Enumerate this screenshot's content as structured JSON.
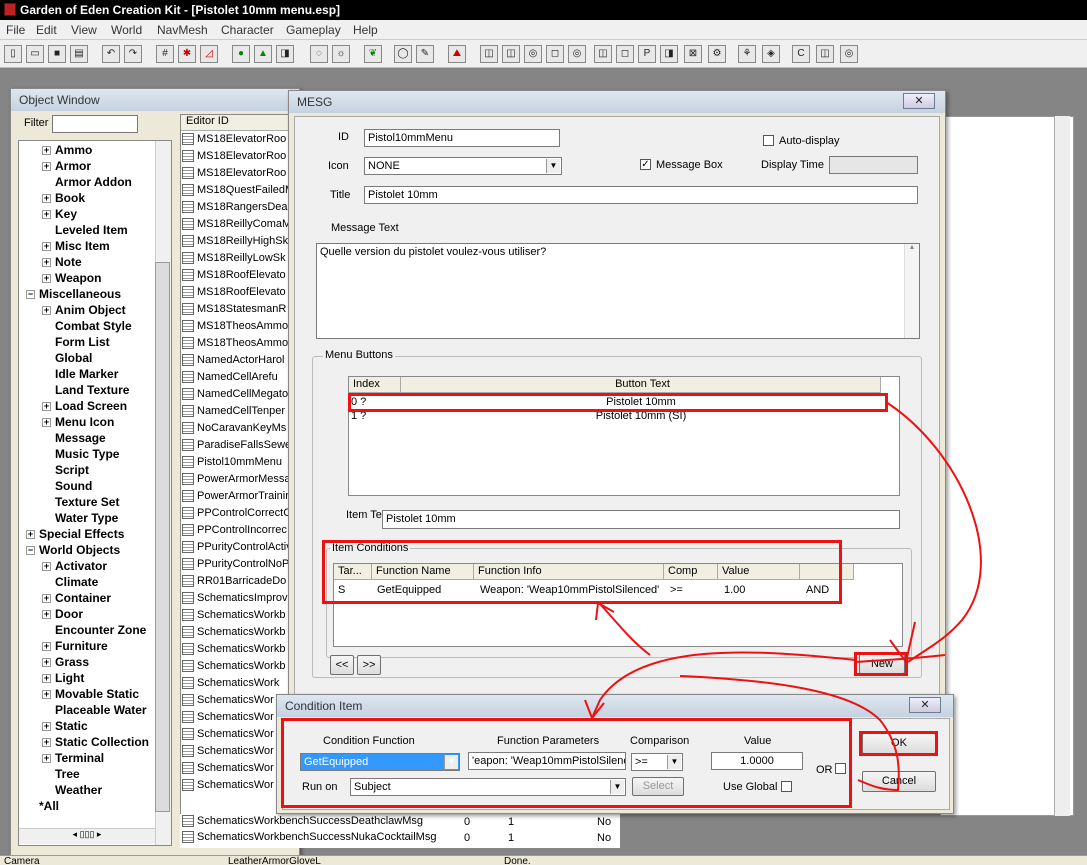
{
  "app": {
    "title": "Garden of Eden Creation Kit - [Pistolet 10mm menu.esp]"
  },
  "menu": [
    "File",
    "Edit",
    "View",
    "World",
    "NavMesh",
    "Character",
    "Gameplay",
    "Help"
  ],
  "object_window": {
    "title": "Object Window",
    "filter_label": "Filter",
    "editor_id_header": "Editor ID",
    "tree": [
      {
        "label": "Ammo",
        "level": 1,
        "exp": "+"
      },
      {
        "label": "Armor",
        "level": 1,
        "exp": "+"
      },
      {
        "label": "Armor Addon",
        "level": 1,
        "exp": ""
      },
      {
        "label": "Book",
        "level": 1,
        "exp": "+"
      },
      {
        "label": "Key",
        "level": 1,
        "exp": "+"
      },
      {
        "label": "Leveled Item",
        "level": 1,
        "exp": ""
      },
      {
        "label": "Misc Item",
        "level": 1,
        "exp": "+"
      },
      {
        "label": "Note",
        "level": 1,
        "exp": "+"
      },
      {
        "label": "Weapon",
        "level": 1,
        "exp": "+"
      },
      {
        "label": "Miscellaneous",
        "level": 0,
        "exp": "−"
      },
      {
        "label": "Anim Object",
        "level": 1,
        "exp": "+"
      },
      {
        "label": "Combat Style",
        "level": 1,
        "exp": ""
      },
      {
        "label": "Form List",
        "level": 1,
        "exp": ""
      },
      {
        "label": "Global",
        "level": 1,
        "exp": ""
      },
      {
        "label": "Idle Marker",
        "level": 1,
        "exp": ""
      },
      {
        "label": "Land Texture",
        "level": 1,
        "exp": ""
      },
      {
        "label": "Load Screen",
        "level": 1,
        "exp": "+"
      },
      {
        "label": "Menu Icon",
        "level": 1,
        "exp": "+"
      },
      {
        "label": "Message",
        "level": 1,
        "exp": ""
      },
      {
        "label": "Music Type",
        "level": 1,
        "exp": ""
      },
      {
        "label": "Script",
        "level": 1,
        "exp": ""
      },
      {
        "label": "Sound",
        "level": 1,
        "exp": ""
      },
      {
        "label": "Texture Set",
        "level": 1,
        "exp": ""
      },
      {
        "label": "Water Type",
        "level": 1,
        "exp": ""
      },
      {
        "label": "Special Effects",
        "level": 0,
        "exp": "+"
      },
      {
        "label": "World Objects",
        "level": 0,
        "exp": "−"
      },
      {
        "label": "Activator",
        "level": 1,
        "exp": "+"
      },
      {
        "label": "Climate",
        "level": 1,
        "exp": ""
      },
      {
        "label": "Container",
        "level": 1,
        "exp": "+"
      },
      {
        "label": "Door",
        "level": 1,
        "exp": "+"
      },
      {
        "label": "Encounter Zone",
        "level": 1,
        "exp": ""
      },
      {
        "label": "Furniture",
        "level": 1,
        "exp": "+"
      },
      {
        "label": "Grass",
        "level": 1,
        "exp": "+"
      },
      {
        "label": "Light",
        "level": 1,
        "exp": "+"
      },
      {
        "label": "Movable Static",
        "level": 1,
        "exp": "+"
      },
      {
        "label": "Placeable Water",
        "level": 1,
        "exp": ""
      },
      {
        "label": "Static",
        "level": 1,
        "exp": "+"
      },
      {
        "label": "Static Collection",
        "level": 1,
        "exp": "+"
      },
      {
        "label": "Terminal",
        "level": 1,
        "exp": "+"
      },
      {
        "label": "Tree",
        "level": 1,
        "exp": ""
      },
      {
        "label": "Weather",
        "level": 1,
        "exp": ""
      },
      {
        "label": "*All",
        "level": 0,
        "exp": ""
      }
    ],
    "editor_ids": [
      "MS18ElevatorRoo",
      "MS18ElevatorRoo",
      "MS18ElevatorRoo",
      "MS18QuestFailedM",
      "MS18RangersDea",
      "MS18ReillyComaM",
      "MS18ReillyHighSk",
      "MS18ReillyLowSk",
      "MS18RoofElevato",
      "MS18RoofElevato",
      "MS18StatesmanR",
      "MS18TheosAmmo",
      "MS18TheosAmmo",
      "NamedActorHarol",
      "NamedCellArefu",
      "NamedCellMegato",
      "NamedCellTenper",
      "NoCaravanKeyMs",
      "ParadiseFallsSewe",
      "Pistol10mmMenu",
      "PowerArmorMessa",
      "PowerArmorTrainin",
      "PPControlCorrectC",
      "PPControlIncorrec",
      "PPurityControlActiv",
      "PPurityControlNoP",
      "RR01BarricadeDo",
      "SchematicsImprov",
      "SchematicsWorkb",
      "SchematicsWorkb",
      "SchematicsWorkb",
      "SchematicsWorkb",
      "SchematicsWork",
      "SchematicsWor",
      "SchematicsWor",
      "SchematicsWor",
      "SchematicsWor",
      "SchematicsWor",
      "SchematicsWor"
    ],
    "bottom_rows": [
      {
        "id": "SchematicsWorkbenchSuccessDeathclawMsg",
        "c1": "0",
        "c2": "1",
        "c3": "No"
      },
      {
        "id": "SchematicsWorkbenchSuccessNukaCocktailMsg",
        "c1": "0",
        "c2": "1",
        "c3": "No"
      }
    ]
  },
  "mesg": {
    "title": "MESG",
    "id_label": "ID",
    "id_value": "Pistol10mmMenu",
    "icon_label": "Icon",
    "icon_value": "NONE",
    "title_label": "Title",
    "title_value": "Pistolet 10mm",
    "auto_display": "Auto-display",
    "message_box": "Message Box",
    "display_time": "Display Time",
    "message_text_label": "Message Text",
    "message_text": "Quelle version du pistolet voulez-vous utiliser?",
    "menu_buttons_label": "Menu Buttons",
    "btn_cols": [
      "Index",
      "Button Text"
    ],
    "btn_rows": [
      {
        "index": "0 ?",
        "text": "Pistolet 10mm"
      },
      {
        "index": "1 ?",
        "text": "Pistolet 10mm (SI)"
      }
    ],
    "item_text_label": "Item Text",
    "item_text": "Pistolet 10mm",
    "item_conditions_label": "Item Conditions",
    "cond_cols": [
      "Tar...",
      "Function Name",
      "Function Info",
      "Comp",
      "Value"
    ],
    "cond_rows": [
      {
        "tar": "S",
        "fn": "GetEquipped",
        "info": "Weapon: 'Weap10mmPistolSilenced'",
        "comp": ">=",
        "value": "1.00",
        "op": "AND"
      }
    ],
    "prev": "<<",
    "next": ">>",
    "new_btn": "New"
  },
  "condition_item": {
    "title": "Condition Item",
    "condition_function_label": "Condition Function",
    "condition_function": "GetEquipped",
    "function_parameters_label": "Function Parameters",
    "function_parameters": "'eapon: 'Weap10mmPistolSilence",
    "comparison_label": "Comparison",
    "comparison": ">=",
    "value_label": "Value",
    "value": "1.0000",
    "or_label": "OR",
    "run_on_label": "Run on",
    "run_on": "Subject",
    "select_btn": "Select",
    "use_global": "Use Global",
    "ok": "OK",
    "cancel": "Cancel"
  },
  "status": {
    "left": "Camera",
    "middle": "LeatherArmorGloveL",
    "right": "Done."
  }
}
